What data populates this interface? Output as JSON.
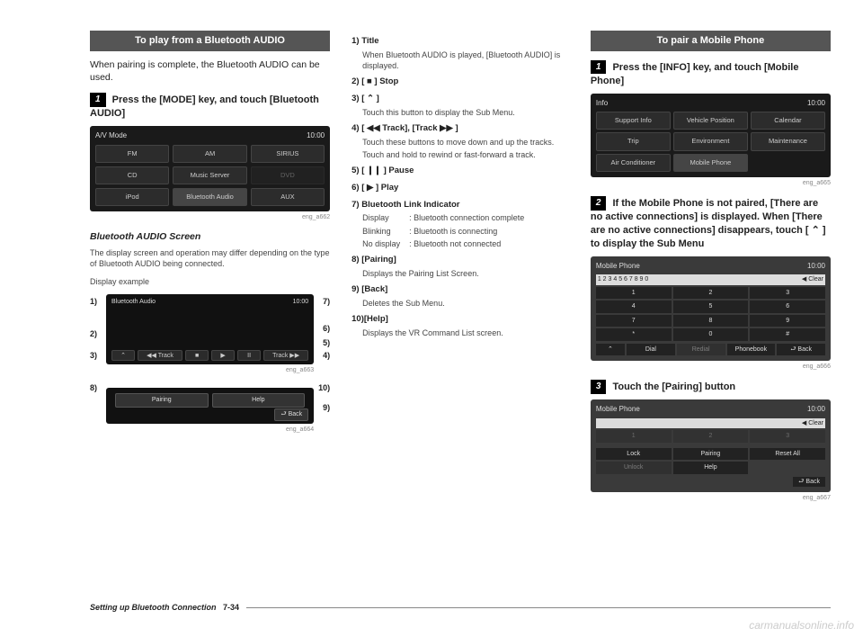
{
  "col1": {
    "header": "To play from a Bluetooth AUDIO",
    "intro": "When pairing is complete, the Bluetooth AUDIO can be used.",
    "step1_num": "1",
    "step1": "Press the [MODE] key, and touch [Bluetooth AUDIO]",
    "fig1": {
      "title_left": "A/V Mode",
      "title_right": "10:00",
      "row1": [
        "FM",
        "AM",
        "SIRIUS"
      ],
      "row2": [
        "CD",
        "Music Server",
        "DVD"
      ],
      "row3": [
        "iPod",
        "Bluetooth Audio",
        "AUX"
      ],
      "cap": "eng_a662"
    },
    "sub": "Bluetooth AUDIO Screen",
    "sub_text": "The display screen and operation may differ depending on the type of Bluetooth AUDIO being connected.",
    "example": "Display example",
    "labels": {
      "l1": "1)",
      "l2": "2)",
      "l3": "3)",
      "l4": "4)",
      "l5": "5)",
      "l6": "6)",
      "l7": "7)",
      "l8": "8)",
      "l9": "9)",
      "l10": "10)"
    },
    "screenA": {
      "title": "Bluetooth Audio",
      "time": "10:00",
      "ctrl": [
        "⌃",
        "◀◀ Track",
        "■",
        "▶",
        "II",
        "Track ▶▶"
      ]
    },
    "screenB": {
      "pairing": "Pairing",
      "help": "Help",
      "back": "⮐ Back"
    },
    "capA": "eng_a663",
    "capB": "eng_a664"
  },
  "col2": {
    "items": [
      {
        "n": "1)",
        "t": "Title",
        "d": "When Bluetooth AUDIO is played, [Bluetooth AUDIO] is displayed."
      },
      {
        "n": "2)",
        "t": "[ ■ ] Stop",
        "d": ""
      },
      {
        "n": "3)",
        "t": "[ ⌃ ]",
        "d": "Touch this button to display the Sub Menu."
      },
      {
        "n": "4)",
        "t": "[ ◀◀ Track], [Track ▶▶ ]",
        "d": "Touch these buttons to move down and up the tracks.",
        "d2": "Touch and hold to rewind or fast-forward a track."
      },
      {
        "n": "5)",
        "t": "[ ❙❙ ] Pause",
        "d": ""
      },
      {
        "n": "6)",
        "t": "[ ▶ ] Play",
        "d": ""
      },
      {
        "n": "7)",
        "t": "Bluetooth Link Indicator",
        "lines": [
          [
            "Display",
            ": Bluetooth connection complete"
          ],
          [
            "Blinking",
            ": Bluetooth is connecting"
          ],
          [
            "No display",
            ": Bluetooth not connected"
          ]
        ]
      },
      {
        "n": "8)",
        "t": "[Pairing]",
        "d": "Displays the Pairing List Screen."
      },
      {
        "n": "9)",
        "t": "[Back]",
        "d": "Deletes the Sub Menu."
      },
      {
        "n": "10)",
        "t": "[Help]",
        "d": "Displays the VR Command List screen."
      }
    ]
  },
  "col3": {
    "header": "To pair a Mobile Phone",
    "step1_num": "1",
    "step1": "Press the [INFO] key, and touch [Mobile Phone]",
    "fig1": {
      "title_left": "Info",
      "title_right": "10:00",
      "items": [
        "Support Info",
        "Vehicle Position",
        "Calendar",
        "Trip",
        "Environment",
        "Maintenance",
        "Air Conditioner",
        "Mobile Phone"
      ],
      "cap": "eng_a665"
    },
    "step2_num": "2",
    "step2": "If the Mobile Phone is not paired, [There are no active connections] is displayed. When [There are no active connections] disappears, touch [ ⌃ ] to display the Sub Menu",
    "fig2": {
      "title_left": "Mobile Phone",
      "title_right": "10:00",
      "hdr_left": "1 2 3 4 5 6 7 8 9 0",
      "hdr_right": "◀ Clear",
      "rows": [
        [
          "1",
          "2",
          "3"
        ],
        [
          "4",
          "5",
          "6"
        ],
        [
          "7",
          "8",
          "9"
        ],
        [
          "*",
          "0",
          "#"
        ]
      ],
      "btns": [
        "⌃",
        "Dial",
        "Redial",
        "Phonebook",
        "⮐ Back"
      ],
      "cap": "eng_a666"
    },
    "step3_num": "3",
    "step3": "Touch the [Pairing] button",
    "fig3": {
      "title_left": "Mobile Phone",
      "title_right": "10:00",
      "hdr_right": "◀ Clear",
      "rows": [
        [
          "1",
          "2",
          "3"
        ]
      ],
      "btns1": [
        "Lock",
        "Pairing",
        "Reset All"
      ],
      "btns2": [
        "Unlock",
        "Help"
      ],
      "back": "⮐ Back",
      "cap": "eng_a667"
    }
  },
  "footer": {
    "title": "Setting up Bluetooth Connection",
    "page": "7-34"
  },
  "watermark": "carmanualsonline.info"
}
